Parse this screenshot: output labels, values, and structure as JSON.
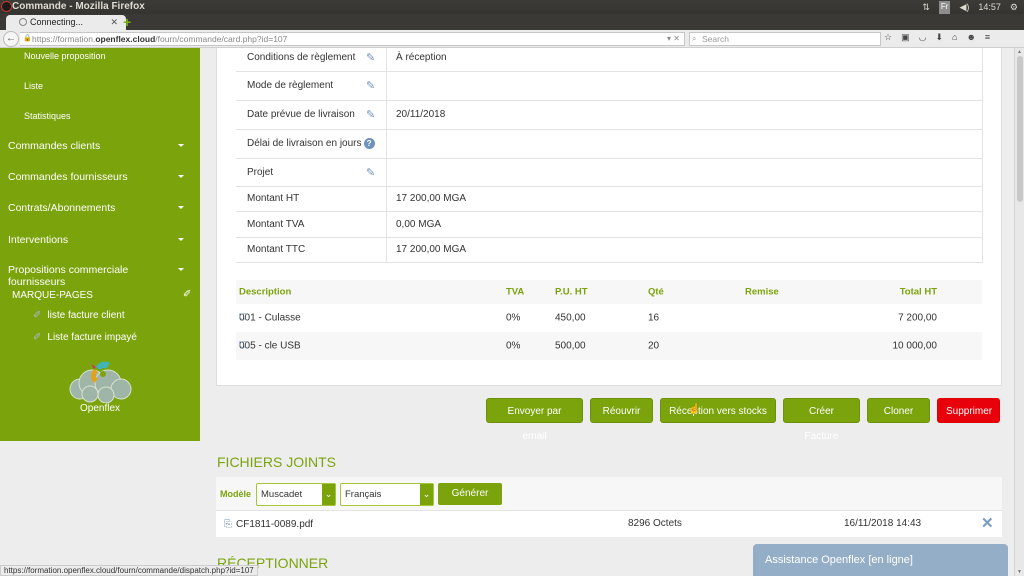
{
  "window": {
    "title": "Commande - Mozilla Firefox",
    "tab_label": "Connecting...",
    "system": {
      "keyboard": "Fr",
      "time": "14:57"
    }
  },
  "browser": {
    "url_prefix": "https://formation.",
    "url_domain": "openflex.cloud",
    "url_path": "/fourn/commande/card.php?id=107",
    "search_placeholder": "Search",
    "status_url": "https://formation.openflex.cloud/fourn/commande/dispatch.php?id=107"
  },
  "sidebar": {
    "sub_items": [
      "Nouvelle proposition",
      "Liste",
      "Statistiques"
    ],
    "menus": [
      "Commandes clients",
      "Commandes fournisseurs",
      "Contrats/Abonnements",
      "Interventions",
      "Propositions commerciale fournisseurs"
    ],
    "bookmarks_title": "MARQUE-PAGES",
    "bookmarks": [
      "liste facture client",
      "Liste facture impayé"
    ],
    "logo_text": "Openflex"
  },
  "fields": [
    {
      "label": "Conditions de règlement",
      "value": "À réception",
      "editable": true
    },
    {
      "label": "Mode de règlement",
      "value": "",
      "editable": true
    },
    {
      "label": "Date prévue de livraison",
      "value": "20/11/2018",
      "editable": true
    },
    {
      "label": "Délai de livraison en jours",
      "value": "",
      "editable": false,
      "help": true
    },
    {
      "label": "Projet",
      "value": "",
      "editable": true
    },
    {
      "label": "Montant HT",
      "value": "17 200,00 MGA",
      "editable": false
    },
    {
      "label": "Montant TVA",
      "value": "0,00 MGA",
      "editable": false
    },
    {
      "label": "Montant TTC",
      "value": "17 200,00 MGA",
      "editable": false
    }
  ],
  "lines": {
    "headers": {
      "description": "Description",
      "tva": "TVA",
      "pu_ht": "P.U. HT",
      "qte": "Qté",
      "remise": "Remise",
      "total_ht": "Total HT"
    },
    "rows": [
      {
        "description": "001 - Culasse",
        "tva": "0%",
        "pu_ht": "450,00",
        "qte": "16",
        "remise": "",
        "total_ht": "7 200,00"
      },
      {
        "description": "005 - cle USB",
        "tva": "0%",
        "pu_ht": "500,00",
        "qte": "20",
        "remise": "",
        "total_ht": "10 000,00"
      }
    ]
  },
  "actions": {
    "send_email": "Envoyer par email",
    "reopen": "Réouvrir",
    "receive_stock": "Réception vers stocks",
    "create_invoice": "Créer Facture",
    "clone": "Cloner",
    "delete": "Supprimer"
  },
  "attachments": {
    "title": "FICHIERS JOINTS",
    "model_label": "Modèle",
    "model_value": "Muscadet",
    "lang_value": "Français",
    "generate_label": "Générer",
    "file": {
      "name": "CF1811-0089.pdf",
      "size": "8296 Octets",
      "date": "16/11/2018 14:43"
    }
  },
  "reception_title": "RÉCEPTIONNER",
  "chat": {
    "label": "Assistance Openflex [en ligne]"
  },
  "colors": {
    "brand_green": "#7ba30c",
    "danger_red": "#e8010a",
    "chat_blue": "#93aec6"
  }
}
